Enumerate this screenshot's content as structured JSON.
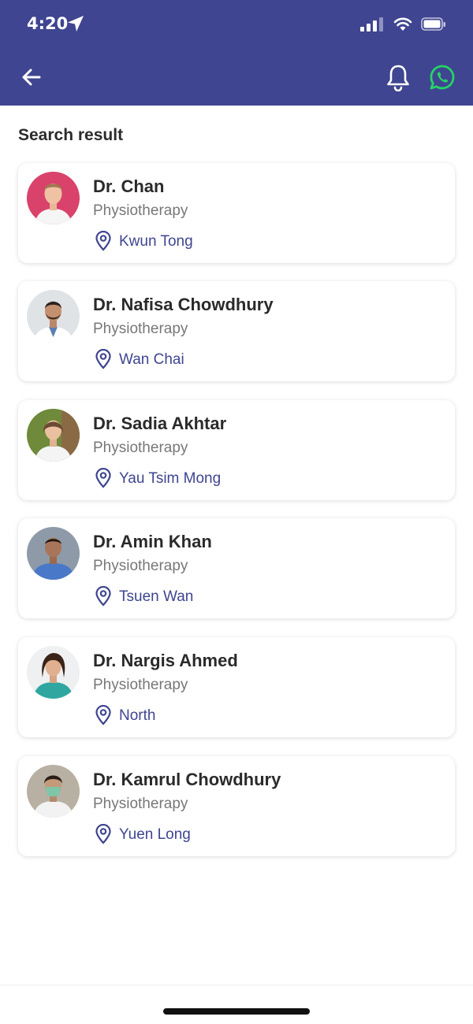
{
  "status_bar": {
    "time": "4:20"
  },
  "header": {
    "icons": [
      "back-arrow-icon",
      "bell-icon",
      "whatsapp-icon"
    ],
    "accent_color": "#3f4590",
    "whatsapp_color": "#25d366"
  },
  "section_title": "Search result",
  "doctors": [
    {
      "name": "Dr. Chan",
      "specialty": "Physiotherapy",
      "location": "Kwun Tong"
    },
    {
      "name": "Dr. Nafisa Chowdhury",
      "specialty": "Physiotherapy",
      "location": "Wan Chai"
    },
    {
      "name": "Dr. Sadia Akhtar",
      "specialty": "Physiotherapy",
      "location": "Yau Tsim Mong"
    },
    {
      "name": "Dr. Amin Khan",
      "specialty": "Physiotherapy",
      "location": "Tsuen Wan"
    },
    {
      "name": "Dr. Nargis Ahmed",
      "specialty": "Physiotherapy",
      "location": "North"
    },
    {
      "name": "Dr. Kamrul Chowdhury",
      "specialty": "Physiotherapy",
      "location": "Yuen Long"
    }
  ]
}
